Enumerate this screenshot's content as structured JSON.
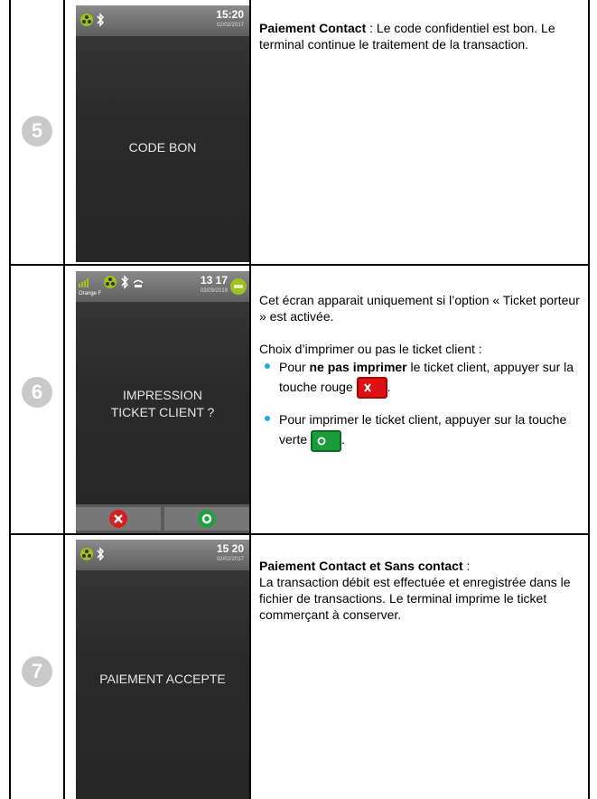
{
  "rows": [
    {
      "step": "5",
      "screen": {
        "time": "15:20",
        "date": "02/02/2017",
        "message": "CODE BON"
      },
      "desc": {
        "bold": "Paiement Contact",
        "text": " : Le code confidentiel est bon. Le terminal continue le traitement de la transaction."
      }
    },
    {
      "step": "6",
      "screen": {
        "time": "13 17",
        "date": "03/09/2019",
        "network": "Orange F",
        "line1": "IMPRESSION",
        "line2": "TICKET CLIENT ?"
      },
      "desc": {
        "intro": "Cet écran apparait uniquement si l’option « Ticket porteur » est activée.",
        "choice": "Choix d’imprimer ou pas le ticket client :",
        "b1_pre": "Pour ",
        "b1_bold": "ne pas imprimer",
        "b1_post": " le ticket client, appuyer sur la touche rouge",
        "b2": "Pour imprimer le ticket client, appuyer sur la touche verte"
      }
    },
    {
      "step": "7",
      "screen": {
        "time": "15 20",
        "date": "02/02/2017",
        "message": "PAIEMENT ACCEPTE"
      },
      "desc": {
        "bold": "Paiement Contact et Sans contact",
        "bold_suffix": " :",
        "text": "La transaction débit est effectuée et enregistrée dans le fichier de transactions. Le terminal imprime le ticket commerçant à conserver."
      }
    }
  ],
  "colors": {
    "bullet": "#2aa9e0",
    "red_key": "#dd1111",
    "green_key": "#1c9b3a"
  },
  "icons": [
    "bluetooth-icon",
    "signal-icon",
    "battery-icon",
    "close-icon",
    "ok-icon"
  ]
}
